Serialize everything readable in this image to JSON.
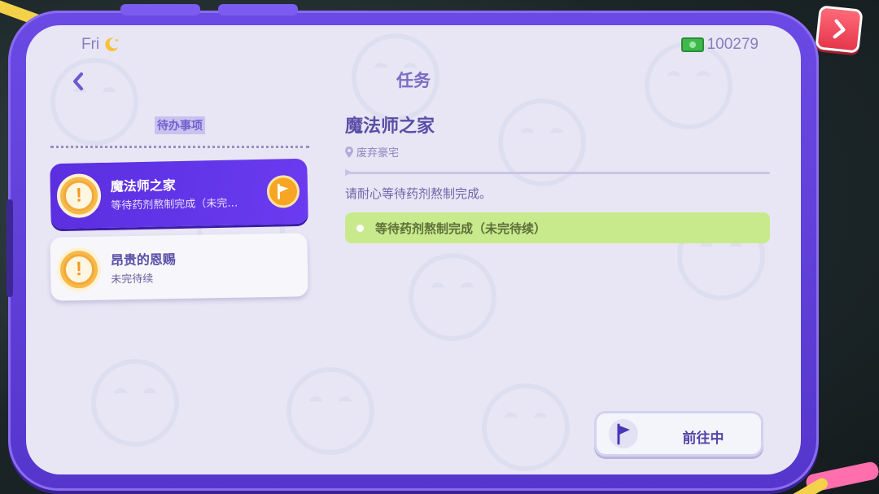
{
  "status": {
    "day": "Fri",
    "time_icon": "moon-icon"
  },
  "currency": {
    "icon": "cash-icon",
    "value": "100279"
  },
  "header": {
    "title": "任务",
    "back_icon": "chevron-left-icon"
  },
  "todo": {
    "header": "待办事项"
  },
  "quests": [
    {
      "name": "魔法师之家",
      "subtitle": "等待药剂熬制完成（未完…",
      "icon": "alert-icon",
      "active": true,
      "badge_icon": "flag-icon"
    },
    {
      "name": "昂贵的恩赐",
      "subtitle": "未完待续",
      "icon": "alert-icon",
      "active": false
    }
  ],
  "detail": {
    "title": "魔法师之家",
    "location_icon": "pin-icon",
    "location": "废弃豪宅",
    "description": "请耐心等待药剂熬制完成。",
    "objectives": [
      {
        "text": "等待药剂熬制完成（未完待续）"
      }
    ]
  },
  "actions": {
    "go_label": "前往中",
    "go_icon": "flag-icon",
    "next_icon": "chevron-right-icon"
  },
  "colors": {
    "accent": "#5b2ee0",
    "frame": "#6a4ae4",
    "objective_bg": "#c9ea8c",
    "alert": "#f6b94a"
  }
}
